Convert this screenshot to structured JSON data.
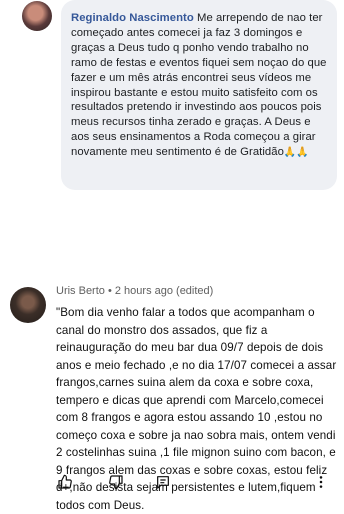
{
  "facebook_comment": {
    "author": "Reginaldo Nascimento",
    "text": "Me arrependo de nao ter começado antes comecei ja faz 3 domingos e graças a Deus tudo q ponho vendo trabalho no ramo de festas e eventos fiquei sem noçao do que fazer e um mês atrás encontrei seus vídeos me inspirou bastante e estou muito satisfeito com os resultados pretendo ir investindo aos poucos pois meus recursos tinha zerado e graças. A Deus e aos seus ensinamentos a Roda começou a girar novamente meu sentimento é de Gratidão",
    "emoji": "🙏🙏"
  },
  "youtube_comment": {
    "author": "Uris Berto",
    "meta": "• 2 hours ago (edited)",
    "text": "\"Bom dia venho falar a todos que acompanham o canal do monstro dos assados, que fiz a reinauguração do meu bar dua 09/7 depois de dois anos e meio fechado ,e no dia 17/07 comecei a assar frangos,carnes suina alem da coxa e sobre coxa, tempero e dicas que aprendi com Marcelo,comecei com 8 frangos e agora estou assando 10 ,estou no começo coxa e sobre ja nao sobra mais, ontem vendi 2 costelinhas suina ,1 file mignon suino com bacon, e 9 frangos alem das coxas e sobre coxas, estou feliz d+,não desista sejam persistentes e lutem,fiquem todos com Deus.",
    "actions": {
      "like": "thumbs-up-icon",
      "dislike": "thumbs-down-icon",
      "reply": "reply-icon",
      "more": "more-vertical-icon"
    }
  }
}
